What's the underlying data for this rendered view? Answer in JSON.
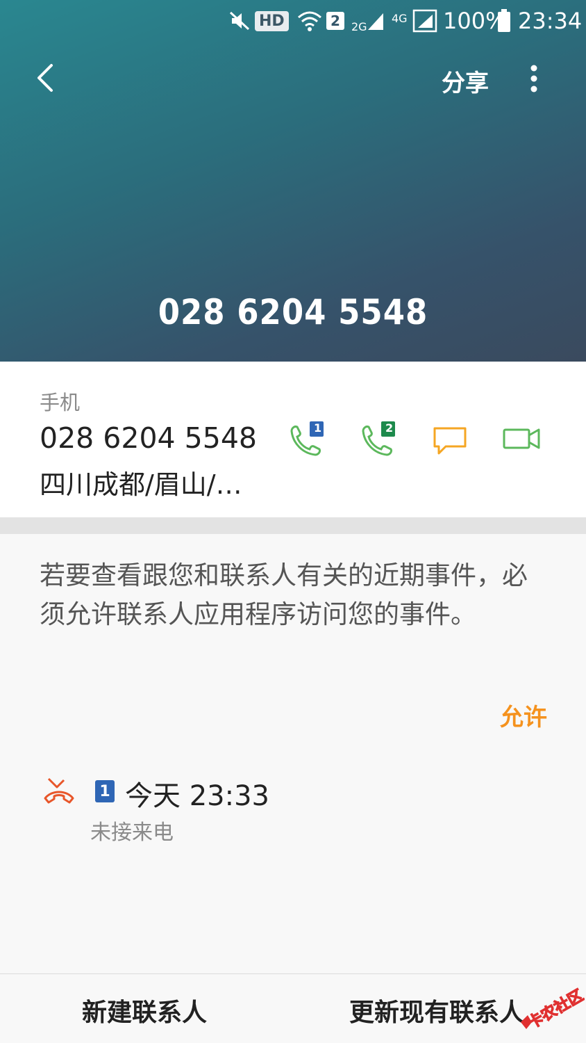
{
  "status_bar": {
    "hd": "HD",
    "sim_badge": "2",
    "net_2g": "2G",
    "net_4g": "4G",
    "battery": "100%",
    "time": "23:34"
  },
  "topbar": {
    "share_label": "分享"
  },
  "header": {
    "number": "028 6204 5548"
  },
  "contact": {
    "type_label": "手机",
    "number": "028 6204 5548",
    "location": "四川成都/眉山/…",
    "sim1": "1",
    "sim2": "2"
  },
  "permission": {
    "message": "若要查看跟您和联系人有关的近期事件，必须允许联系人应用程序访问您的事件。",
    "allow_label": "允许"
  },
  "call_log": {
    "sim": "1",
    "time": "今天 23:33",
    "status": "未接来电"
  },
  "bottom": {
    "new_contact": "新建联系人",
    "update_contact": "更新现有联系人"
  },
  "watermark": {
    "text": "卡农社区"
  },
  "colors": {
    "call_green": "#5cb85c",
    "message_orange": "#f5a623",
    "allow_orange": "#f5921e",
    "missed_red": "#e8562a",
    "sim_blue": "#2f66b5",
    "sim_green": "#1d8a4c"
  }
}
